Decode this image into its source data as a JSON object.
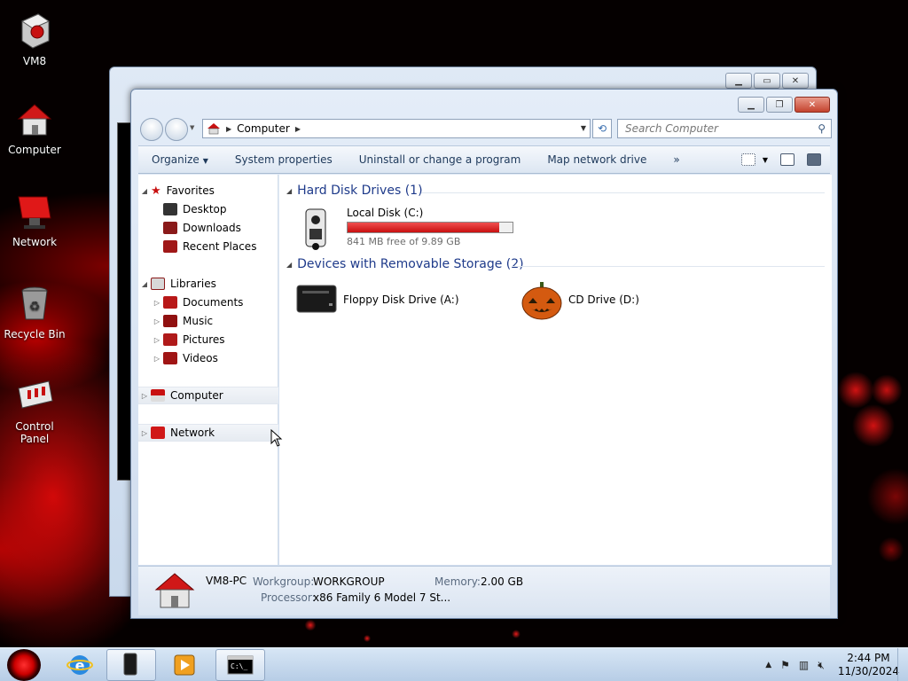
{
  "desktop": {
    "icons": [
      {
        "label": "VM8"
      },
      {
        "label": "Computer"
      },
      {
        "label": "Network"
      },
      {
        "label": "Recycle Bin"
      },
      {
        "label": "Control Panel"
      }
    ]
  },
  "window": {
    "address": {
      "crumb": "Computer"
    },
    "search": {
      "placeholder": "Search Computer"
    },
    "toolbar": {
      "organize": "Organize",
      "system_properties": "System properties",
      "uninstall": "Uninstall or change a program",
      "map_drive": "Map network drive",
      "more": "»"
    },
    "nav_pane": {
      "favorites": "Favorites",
      "desktop": "Desktop",
      "downloads": "Downloads",
      "recent": "Recent Places",
      "libraries": "Libraries",
      "documents": "Documents",
      "music": "Music",
      "pictures": "Pictures",
      "videos": "Videos",
      "computer": "Computer",
      "network": "Network"
    },
    "content": {
      "hdd_group": "Hard Disk Drives (1)",
      "removable_group": "Devices with Removable Storage (2)",
      "local_disk": {
        "name": "Local Disk (C:)",
        "free": "841 MB free of 9.89 GB",
        "used_fraction": 0.917
      },
      "floppy": {
        "name": "Floppy Disk Drive (A:)"
      },
      "cd": {
        "name": "CD Drive (D:)"
      }
    },
    "details": {
      "pc_name": "VM8-PC",
      "workgroup_label": "Workgroup:",
      "workgroup_value": "WORKGROUP",
      "memory_label": "Memory:",
      "memory_value": "2.00 GB",
      "processor_label": "Processor:",
      "processor_value": "x86 Family 6 Model 7 St..."
    }
  },
  "taskbar": {
    "time": "2:44 PM",
    "date": "11/30/2024"
  },
  "colors": {
    "accent_red": "#c81010",
    "header_blue": "#1e3a8a"
  }
}
